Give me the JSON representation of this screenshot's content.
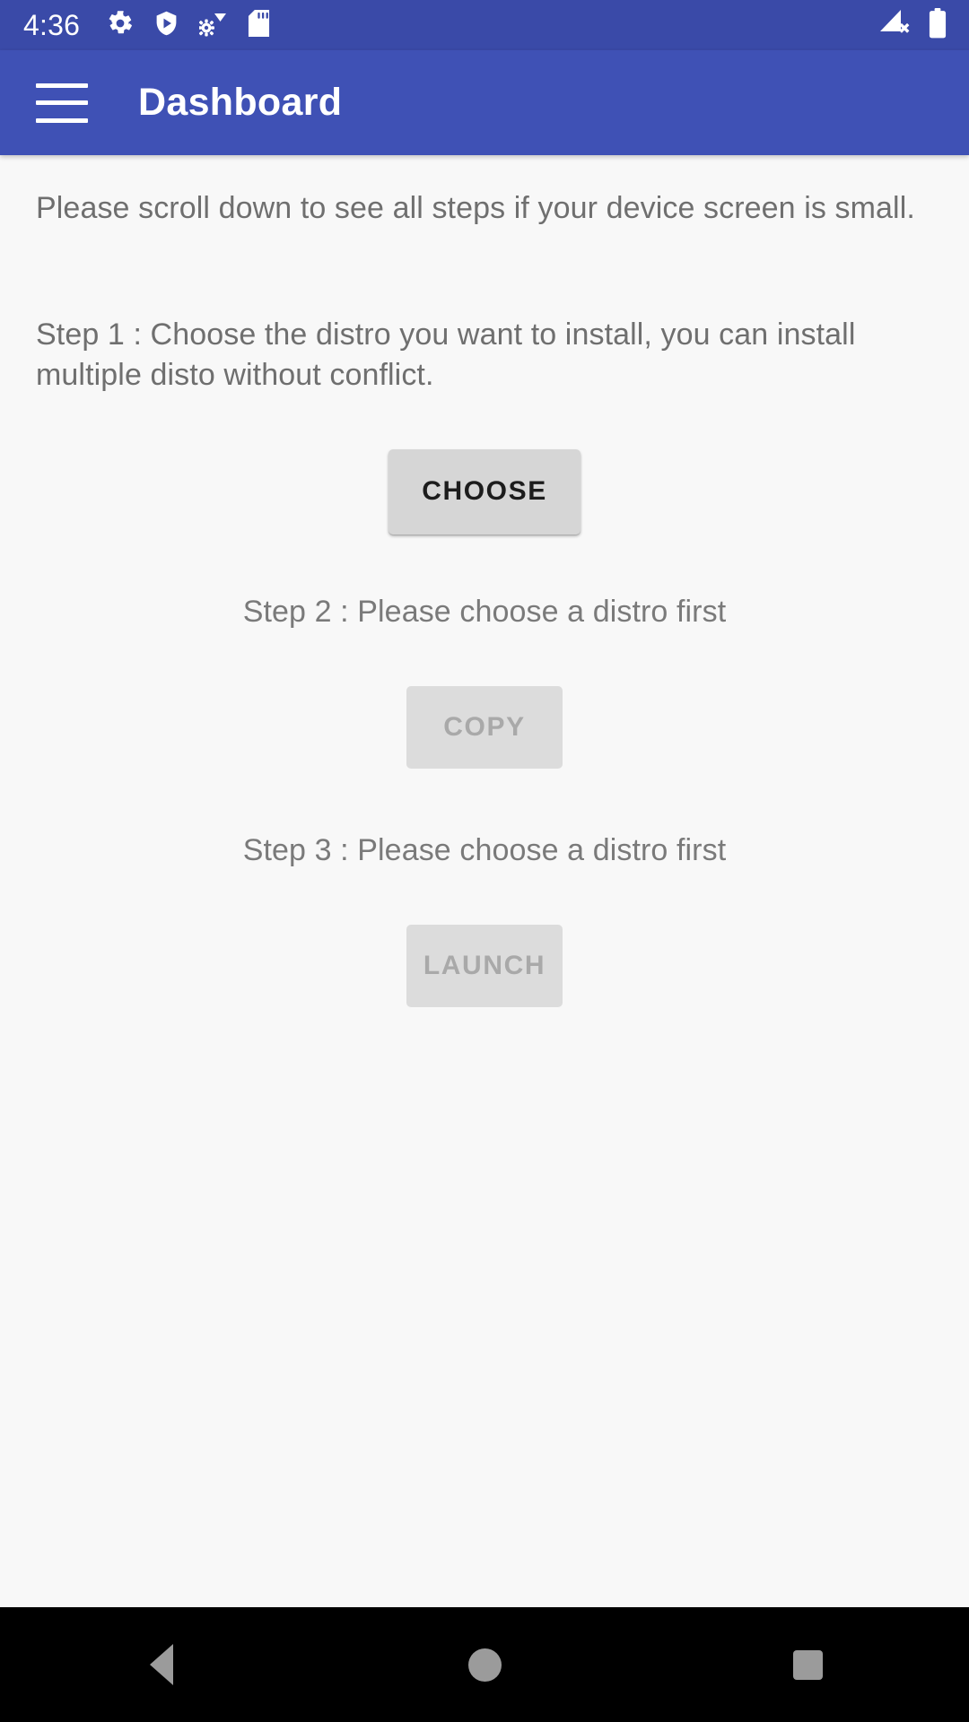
{
  "status_bar": {
    "clock": "4:36",
    "left_icons": [
      "gear-icon",
      "play-protect-shield-icon",
      "developer-settings-wifi-icon",
      "sd-card-icon"
    ],
    "right_icons": [
      "signal-no-service-icon",
      "battery-full-icon"
    ],
    "background_color": "#3a4aa8",
    "foreground_color": "#ffffff"
  },
  "app_bar": {
    "menu_icon": "hamburger-menu-icon",
    "title": "Dashboard",
    "background_color": "#3f51b5",
    "text_color": "#ffffff"
  },
  "content": {
    "intro_text": "Please scroll down to see all steps if your device screen is small.",
    "step1": {
      "description": "Step 1 : Choose the distro you want to install, you can install multiple disto without conflict.",
      "button_label": "CHOOSE",
      "button_enabled": true
    },
    "step2": {
      "label": "Step 2 : Please choose a distro first",
      "button_label": "COPY",
      "button_enabled": false
    },
    "step3": {
      "label": "Step 3 : Please choose a distro first",
      "button_label": "LAUNCH",
      "button_enabled": false
    },
    "background_color": "#f8f8f8",
    "body_text_color": "#6f6f6f"
  },
  "nav_bar": {
    "background_color": "#000000",
    "icon_color": "#9b9b9b",
    "buttons": [
      "back-nav-icon",
      "home-nav-icon",
      "recents-nav-icon"
    ]
  }
}
